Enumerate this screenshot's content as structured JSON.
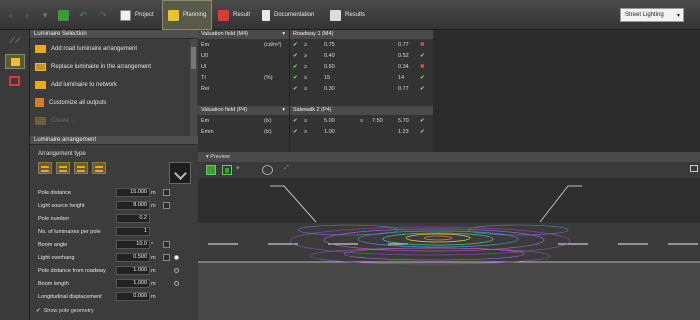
{
  "toolbar": {
    "project": "Project",
    "planning": "Planning",
    "result": "Result",
    "documentation": "Documentation",
    "results": "Results",
    "mode_select": "Street Lighting"
  },
  "luminaire_selection": {
    "title": "Luminaire Selection",
    "actions": [
      {
        "label": "Add road luminaire arrangement"
      },
      {
        "label": "Replace luminaire in the arrangement"
      },
      {
        "label": "Add luminaire to network"
      },
      {
        "label": "Customize all outputs"
      },
      {
        "label": "Create ..."
      }
    ]
  },
  "arrangement": {
    "title": "Luminaire arrangement",
    "type_label": "Arrangement type",
    "params": [
      {
        "label": "Pole distance",
        "value": "15.000",
        "unit": "m",
        "check": true
      },
      {
        "label": "Light source height",
        "value": "8.000",
        "unit": "m",
        "check": true
      },
      {
        "label": "Pole number",
        "value": "0.2",
        "unit": "",
        "check": false
      },
      {
        "label": "No. of luminaires per pole",
        "value": "1",
        "unit": "",
        "check": false
      },
      {
        "label": "Boom angle",
        "value": "10.0",
        "unit": "°",
        "check": true
      },
      {
        "label": "Light overhang",
        "value": "0.500",
        "unit": "m",
        "check": true,
        "radio": "on"
      },
      {
        "label": "Pole distance from roadway",
        "value": "1.000",
        "unit": "m",
        "check": false,
        "radio": "off"
      },
      {
        "label": "Boom length",
        "value": "1.000",
        "unit": "m",
        "check": false,
        "radio": "off"
      },
      {
        "label": "Longitudinal displacement",
        "value": "0.000",
        "unit": "m",
        "check": false
      }
    ],
    "show_pole_label": "Show pole geometry"
  },
  "evaluation": {
    "field1_title": "Valuation field (M4)",
    "field1_rows": [
      {
        "param": "Em",
        "unit": "(cd/m²)"
      },
      {
        "param": "U0",
        "unit": ""
      },
      {
        "param": "Ul",
        "unit": ""
      },
      {
        "param": "TI",
        "unit": "(%)"
      },
      {
        "param": "Rei",
        "unit": ""
      }
    ],
    "field2_title": "Valuation field (P4)",
    "field2_rows": [
      {
        "param": "Em",
        "unit": "(lx)"
      },
      {
        "param": "Emin",
        "unit": "(lx)"
      }
    ],
    "road1_title": "Roadway 1 (M4)",
    "road1_rows": [
      {
        "op": "≥",
        "target": "0.75",
        "actual": "0.77",
        "ok": false
      },
      {
        "op": "≥",
        "target": "0.40",
        "actual": "0.52",
        "ok": true
      },
      {
        "op": "≥",
        "target": "0.60",
        "actual": "0.34",
        "ok": false
      },
      {
        "op": "≤",
        "target": "15",
        "actual": "14",
        "ok": true
      },
      {
        "op": "≥",
        "target": "0.30",
        "actual": "0.77",
        "ok": true
      }
    ],
    "sidewalk_title": "Sidewalk 2 (P4)",
    "sidewalk_rows": [
      {
        "op": "≥",
        "target": "5.00",
        "op2": "≤",
        "target2": "7.50",
        "actual": "5.70",
        "ok": true
      },
      {
        "op": "≥",
        "target": "1.00",
        "actual": "1.23",
        "ok": true
      }
    ]
  },
  "preview": {
    "title": "Preview"
  },
  "colors": {
    "ok": "#6ad56a",
    "fail": "#e35555",
    "accent": "#e8a828"
  }
}
